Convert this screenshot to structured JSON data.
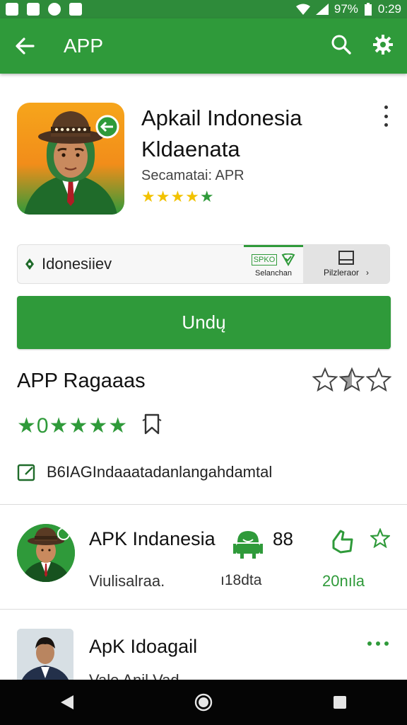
{
  "status_bar": {
    "battery": "97%",
    "time": "0:29"
  },
  "app_bar": {
    "title": "APP"
  },
  "app": {
    "name_line1": "Apkail Indonesia",
    "name_line2": "Kldaenata",
    "subtitle": "Secamatai: APR",
    "rating_stars": "★★★★★"
  },
  "lang": {
    "label": "Idonesiiev",
    "mid_badge": "SPKO",
    "mid_label": "Selanchan",
    "right_label": "Pilzleraor"
  },
  "install": {
    "label": "Undų"
  },
  "ratings": {
    "title": "APP Ragaaas",
    "summary": "★0★★★★",
    "description": "B6IAGIndaaatadanlangahdamtal"
  },
  "list": [
    {
      "title": "APK Indanesia",
      "count": "88",
      "sub": "Viulisalraa.",
      "meta": "ı18dta",
      "right": "20nıla"
    },
    {
      "title": "ApK Idoagail",
      "sub": "Vale Anil Vad"
    }
  ],
  "colors": {
    "brand": "#2f9a3a",
    "star_yellow": "#f2c200",
    "star_green": "#2f9a3a"
  }
}
